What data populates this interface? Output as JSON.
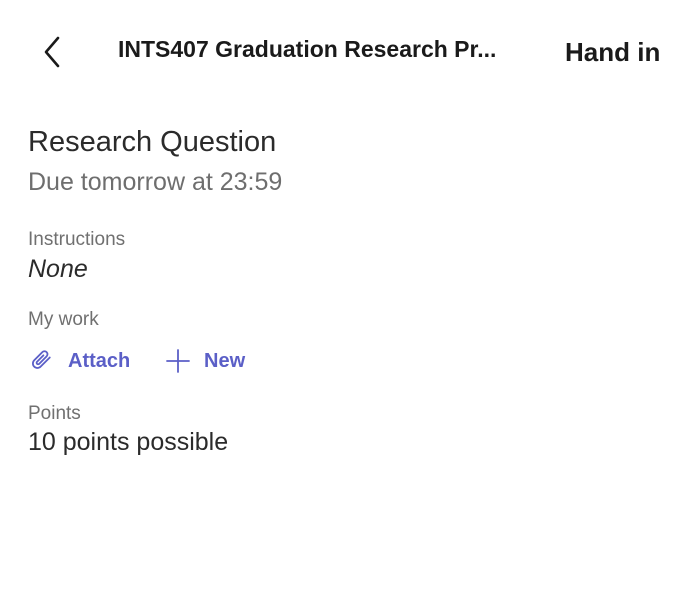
{
  "header": {
    "back_icon": "chevron-left-icon",
    "title": "INTS407 Graduation Research Pr...",
    "hand_in_label": "Hand in"
  },
  "assignment": {
    "title": "Research Question",
    "due": "Due tomorrow at 23:59"
  },
  "instructions": {
    "label": "Instructions",
    "value": "None"
  },
  "my_work": {
    "label": "My work",
    "actions": [
      {
        "icon": "paperclip-icon",
        "label": "Attach"
      },
      {
        "icon": "plus-icon",
        "label": "New"
      }
    ]
  },
  "points": {
    "label": "Points",
    "value": "10 points possible"
  },
  "colors": {
    "accent": "#5b5fc7",
    "text_primary": "#2b2b2b",
    "text_secondary": "#6e6e6e",
    "background": "#ffffff"
  }
}
